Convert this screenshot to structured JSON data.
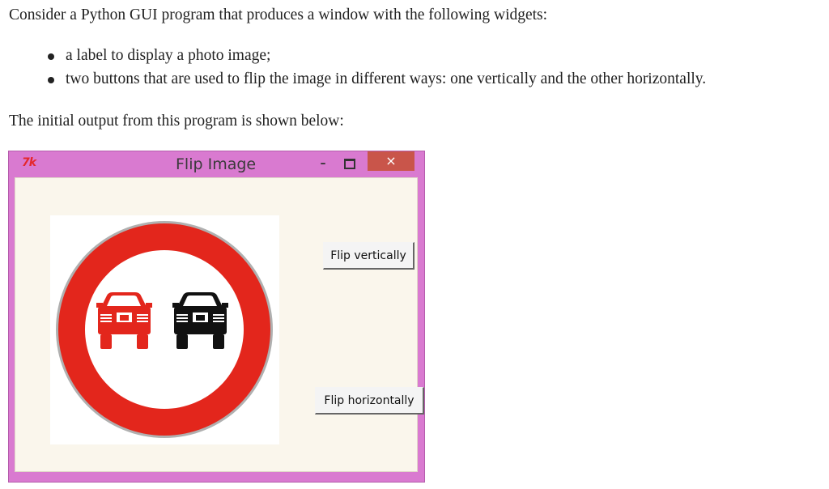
{
  "intro": "Consider a Python GUI program that produces a window with the following widgets:",
  "bullets": [
    "a label to display a photo image;",
    "two buttons that are used to flip the image in different ways: one vertically and the other horizontally."
  ],
  "outro": "The initial output from this program is shown below:",
  "window": {
    "icon_text": "7k",
    "title": "Flip Image",
    "minimize_glyph": "–",
    "close_glyph": "×",
    "buttons": {
      "flip_vertically": "Flip vertically",
      "flip_horizontally": "Flip horizontally"
    },
    "image": {
      "description_icon": "no-overtaking-sign-icon",
      "ring_color": "#e3261c",
      "left_car_color": "#e3261c",
      "right_car_color": "#111111"
    },
    "frame_color": "#d97ad0",
    "client_color": "#faf6ec",
    "close_color": "#c9554a"
  }
}
